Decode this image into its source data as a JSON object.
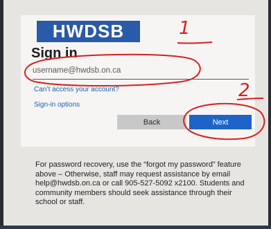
{
  "logo": {
    "text": "HWDSB"
  },
  "signin": {
    "title": "Sign in",
    "username_placeholder": "username@hwdsb.on.ca",
    "cant_access_link": "Can’t access your account?",
    "signin_options_link": "Sign-in options",
    "back_label": "Back",
    "next_label": "Next"
  },
  "info": {
    "text": "For password recovery, use the “forgot my password” feature above – Otherwise, staff may request assistance by email help@hwdsb.on.ca or call 905-527-5092 x2100. Students and community members should seek assistance through their school or staff."
  },
  "annotations": {
    "marker_1": "1",
    "marker_2": "2",
    "color": "#d81e1e"
  },
  "colors": {
    "brand": "#2a5aa8",
    "next_button": "#1e64c8",
    "link": "#1b5fb8"
  }
}
